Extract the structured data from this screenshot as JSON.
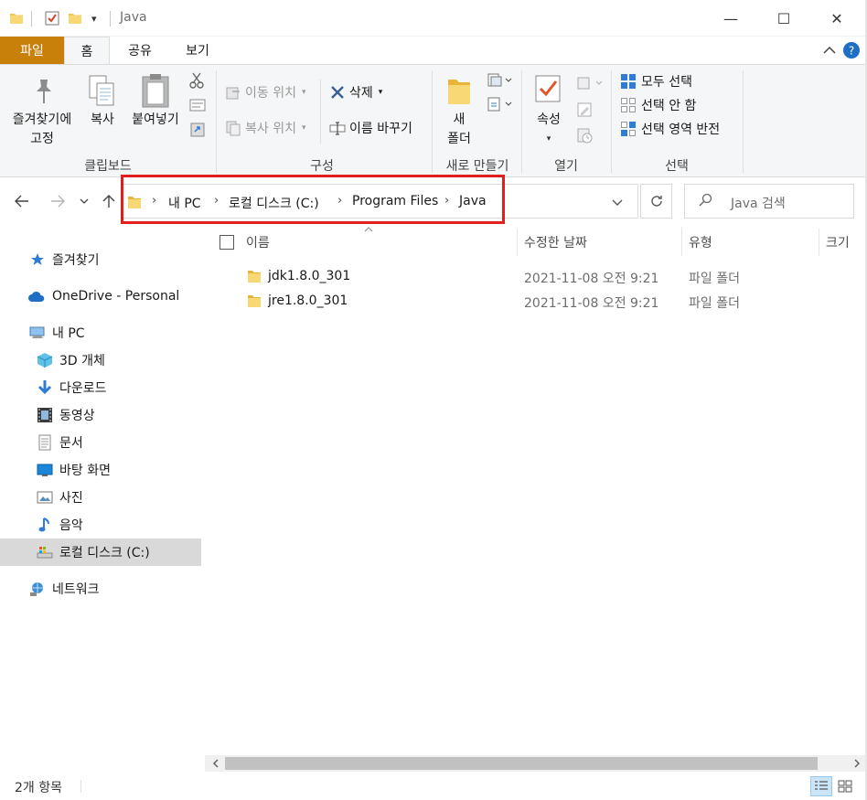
{
  "window": {
    "title": "Java",
    "minimize": "—",
    "maximize": "☐",
    "close": "✕"
  },
  "ribbon_tabs": [
    {
      "label": "파일"
    },
    {
      "label": "홈"
    },
    {
      "label": "공유"
    },
    {
      "label": "보기"
    }
  ],
  "ribbon": {
    "clipboard": {
      "pin_label_1": "즐겨찾기에",
      "pin_label_2": "고정",
      "copy_label": "복사",
      "paste_label": "붙여넣기",
      "group_label": "클립보드"
    },
    "organize": {
      "move_to": "이동 위치",
      "copy_to": "복사 위치",
      "delete": "삭제",
      "rename": "이름 바꾸기",
      "group_label": "구성"
    },
    "new": {
      "new_folder_1": "새",
      "new_folder_2": "폴더",
      "group_label": "새로 만들기"
    },
    "open": {
      "properties": "속성",
      "group_label": "열기"
    },
    "select": {
      "select_all": "모두 선택",
      "select_none": "선택 안 함",
      "invert": "선택 영역 반전",
      "group_label": "선택"
    }
  },
  "address": {
    "crumbs": [
      "내 PC",
      "로컬 디스크 (C:)",
      "Program Files",
      "Java"
    ],
    "search_placeholder": "Java 검색"
  },
  "sidebar": {
    "items": [
      {
        "label": "즐겨찾기",
        "icon": "star-icon"
      },
      {
        "label": "OneDrive - Personal",
        "icon": "cloud-icon"
      },
      {
        "label": "내 PC",
        "icon": "pc-icon"
      },
      {
        "label": "3D 개체",
        "icon": "cube-icon"
      },
      {
        "label": "다운로드",
        "icon": "download-icon"
      },
      {
        "label": "동영상",
        "icon": "video-icon"
      },
      {
        "label": "문서",
        "icon": "document-icon"
      },
      {
        "label": "바탕 화면",
        "icon": "desktop-icon"
      },
      {
        "label": "사진",
        "icon": "picture-icon"
      },
      {
        "label": "음악",
        "icon": "music-icon"
      },
      {
        "label": "로컬 디스크 (C:)",
        "icon": "drive-icon"
      },
      {
        "label": "네트워크",
        "icon": "network-icon"
      }
    ]
  },
  "columns": {
    "name": "이름",
    "date": "수정한 날짜",
    "type": "유형",
    "size": "크기"
  },
  "files": [
    {
      "name": "jdk1.8.0_301",
      "date": "2021-11-08 오전 9:21",
      "type": "파일 폴더"
    },
    {
      "name": "jre1.8.0_301",
      "date": "2021-11-08 오전 9:21",
      "type": "파일 폴더"
    }
  ],
  "status": {
    "count": "2개 항목"
  },
  "colors": {
    "file_tab": "#c8800a",
    "folder": "#f3c54c",
    "highlight": "#e01f1f",
    "accent": "#2e7cd6"
  }
}
